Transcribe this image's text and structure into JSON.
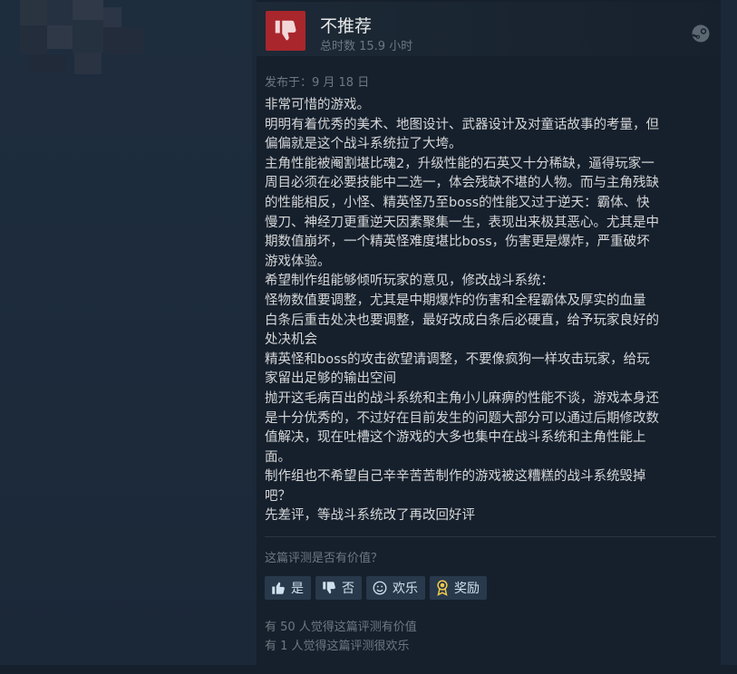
{
  "review": {
    "verdict": "不推荐",
    "hours": "总时数 15.9 小时",
    "posted": "发布于：9 月 18 日",
    "lines": [
      "非常可惜的游戏。",
      "明明有着优秀的美术、地图设计、武器设计及对童话故事的考量，但",
      "偏偏就是这个战斗系统拉了大垮。",
      "主角性能被阉割堪比魂2，升级性能的石英又十分稀缺，逼得玩家一",
      "周目必须在必要技能中二选一，体会残缺不堪的人物。而与主角残缺",
      "的性能相反，小怪、精英怪乃至boss的性能又过于逆天：霸体、快",
      "慢刀、神经刀更重逆天因素聚集一生，表现出来极其恶心。尤其是中",
      "期数值崩坏，一个精英怪难度堪比boss，伤害更是爆炸，严重破坏",
      "游戏体验。",
      "希望制作组能够倾听玩家的意见，修改战斗系统：",
      "怪物数值要调整，尤其是中期爆炸的伤害和全程霸体及厚实的血量",
      "白条后重击处决也要调整，最好改成白条后必硬直，给予玩家良好的",
      "处决机会",
      "精英怪和boss的攻击欲望请调整，不要像疯狗一样攻击玩家，给玩",
      "家留出足够的输出空间",
      "抛开这毛病百出的战斗系统和主角小儿麻痹的性能不谈，游戏本身还",
      "是十分优秀的，不过好在目前发生的问题大部分可以通过后期修改数",
      "值解决，现在吐槽这个游戏的大多也集中在战斗系统和主角性能上",
      "面。",
      "制作组也不希望自己辛辛苦苦制作的游戏被这糟糕的战斗系统毁掉",
      "吧？",
      "先差评，等战斗系统改了再改回好评"
    ],
    "helpful_question": "这篇评测是否有价值？",
    "buttons": {
      "yes": "是",
      "no": "否",
      "funny": "欢乐",
      "award": "奖励"
    },
    "stats": {
      "helpful": "有 50 人觉得这篇评测有价值",
      "funny": "有 1 人觉得这篇评测很欢乐"
    }
  },
  "icons": {
    "verdict": "thumbs-down-icon",
    "platform": "steam-icon",
    "yes": "thumbs-up-icon",
    "no": "thumbs-down-icon",
    "funny": "smiley-icon",
    "award": "award-ribbon-icon"
  },
  "colors": {
    "background": "#1b2838",
    "panel": "#16202d",
    "not_recommended": "#a9262c",
    "button": "#28394b",
    "text": "#d6d7d8",
    "muted": "#6d7880"
  }
}
